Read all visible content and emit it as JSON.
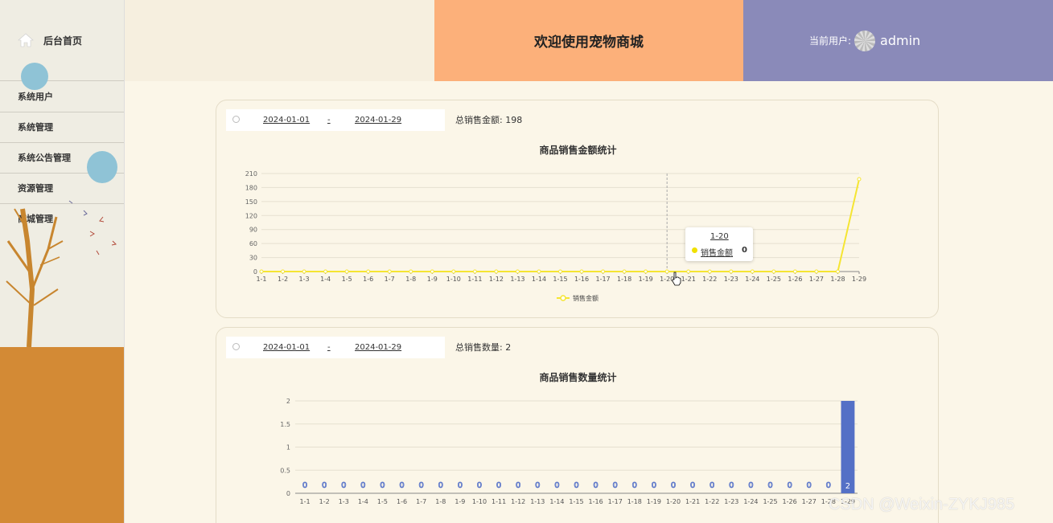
{
  "sidebar": {
    "home_label": "后台首页",
    "items": [
      {
        "label": "系统用户"
      },
      {
        "label": "系统管理"
      },
      {
        "label": "系统公告管理"
      },
      {
        "label": "资源管理"
      },
      {
        "label": "商城管理"
      }
    ]
  },
  "header": {
    "title": "欢迎使用宠物商城",
    "current_user_label": "当前用户:",
    "username": "admin"
  },
  "card1": {
    "date_start": "2024-01-01",
    "date_sep": "-",
    "date_end": "2024-01-29",
    "total_label": "总销售金额:",
    "total_value": "198"
  },
  "card2": {
    "date_start": "2024-01-01",
    "date_sep": "-",
    "date_end": "2024-01-29",
    "total_label": "总销售数量:",
    "total_value": "2"
  },
  "tooltip": {
    "x": "1-20",
    "series": "销售金额",
    "value": "0"
  },
  "watermark": "CSDN @Weixin-ZYKJ985",
  "colors": {
    "line_series": "#f5e532",
    "bar_series": "#5470c6",
    "header_mid": "#fcb07a",
    "header_right": "#8a8ab9",
    "ground": "#d38a35"
  },
  "chart_data": [
    {
      "type": "line",
      "title": "商品销售金额统计",
      "categories": [
        "1-1",
        "1-2",
        "1-3",
        "1-4",
        "1-5",
        "1-6",
        "1-7",
        "1-8",
        "1-9",
        "1-10",
        "1-11",
        "1-12",
        "1-13",
        "1-14",
        "1-15",
        "1-16",
        "1-17",
        "1-18",
        "1-19",
        "1-20",
        "1-21",
        "1-22",
        "1-23",
        "1-24",
        "1-25",
        "1-26",
        "1-27",
        "1-28",
        "1-29"
      ],
      "series": [
        {
          "name": "销售金额",
          "values": [
            0,
            0,
            0,
            0,
            0,
            0,
            0,
            0,
            0,
            0,
            0,
            0,
            0,
            0,
            0,
            0,
            0,
            0,
            0,
            0,
            0,
            0,
            0,
            0,
            0,
            0,
            0,
            0,
            198
          ]
        }
      ],
      "yticks": [
        0,
        30,
        60,
        90,
        120,
        150,
        180,
        210
      ],
      "ylim": [
        0,
        210
      ],
      "legend": "bottom",
      "grid": true
    },
    {
      "type": "bar",
      "title": "商品销售数量统计",
      "categories": [
        "1-1",
        "1-2",
        "1-3",
        "1-4",
        "1-5",
        "1-6",
        "1-7",
        "1-8",
        "1-9",
        "1-10",
        "1-11",
        "1-12",
        "1-13",
        "1-14",
        "1-15",
        "1-16",
        "1-17",
        "1-18",
        "1-19",
        "1-20",
        "1-21",
        "1-22",
        "1-23",
        "1-24",
        "1-25",
        "1-26",
        "1-27",
        "1-28",
        "1-29"
      ],
      "values": [
        0,
        0,
        0,
        0,
        0,
        0,
        0,
        0,
        0,
        0,
        0,
        0,
        0,
        0,
        0,
        0,
        0,
        0,
        0,
        0,
        0,
        0,
        0,
        0,
        0,
        0,
        0,
        0,
        2
      ],
      "yticks": [
        "0",
        "0.5",
        "1",
        "1.5",
        "2"
      ],
      "ylim": [
        0,
        2
      ],
      "data_labels": true,
      "grid": true
    }
  ]
}
